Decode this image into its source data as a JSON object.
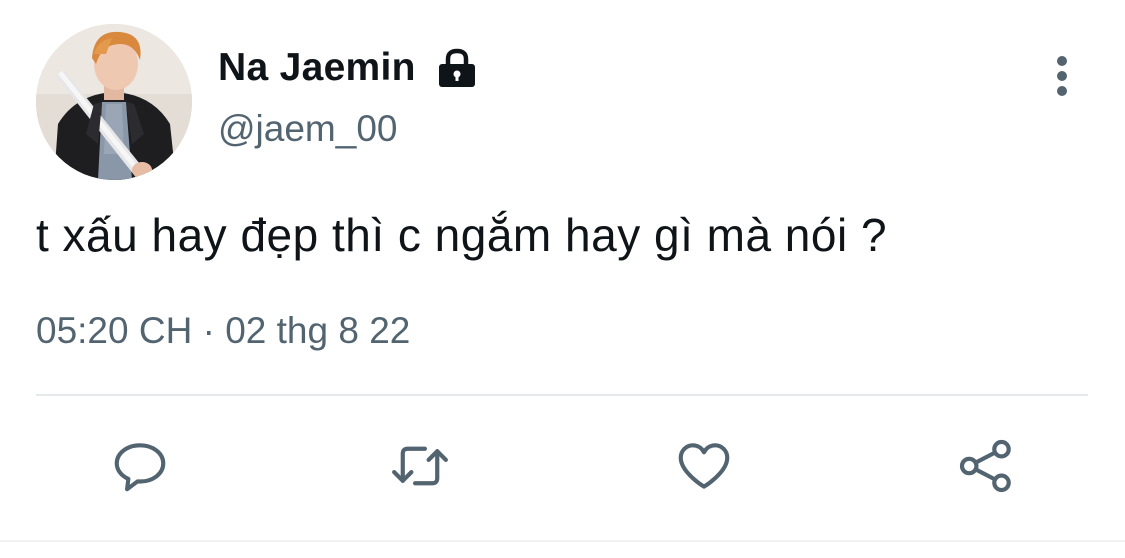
{
  "user": {
    "display_name": "Na Jaemin",
    "handle": "@jaem_00",
    "protected_icon": "lock-icon",
    "avatar_icon": "profile-photo"
  },
  "tweet": {
    "text": "t xấu hay đẹp thì c ngắm hay gì mà nói ?",
    "timestamp": "05:20 CH · 02 thg 8 22"
  },
  "menu": {
    "icon": "more-vertical-icon"
  },
  "actions": [
    {
      "name": "reply",
      "icon": "reply-icon"
    },
    {
      "name": "retweet",
      "icon": "retweet-icon"
    },
    {
      "name": "like",
      "icon": "heart-icon"
    },
    {
      "name": "share",
      "icon": "share-icon"
    }
  ],
  "colors": {
    "primary_text": "#0f1419",
    "secondary_text": "#536471",
    "divider": "#e6e9eb"
  }
}
